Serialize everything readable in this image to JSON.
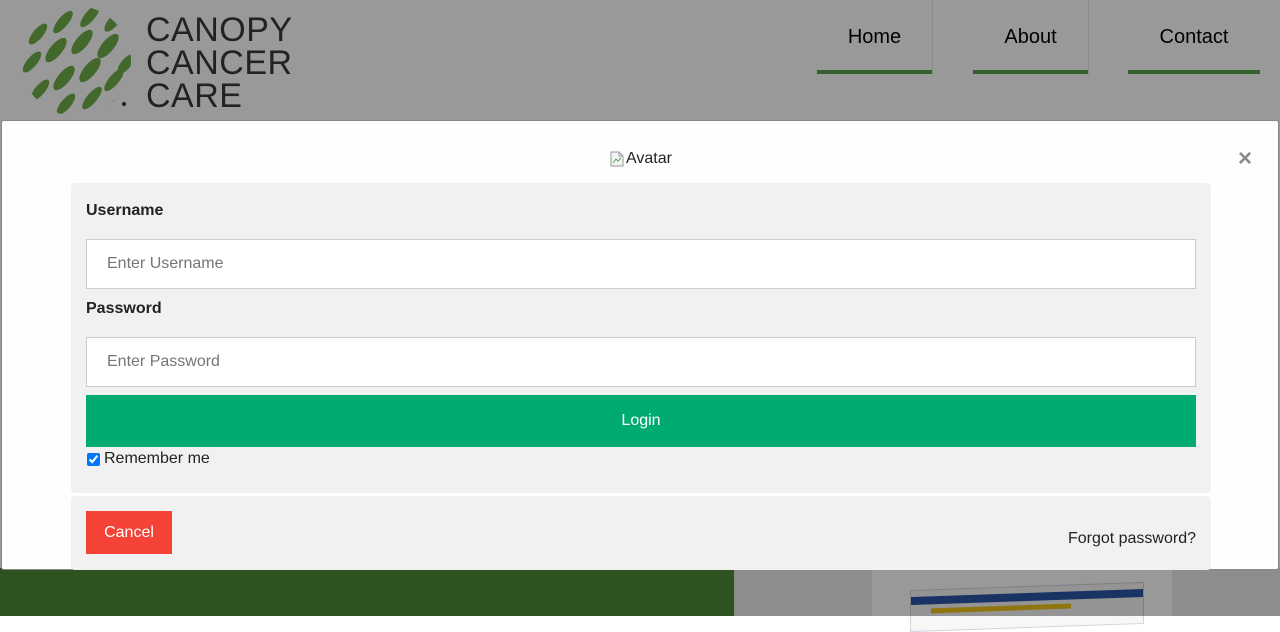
{
  "header": {
    "logo_lines": [
      "CANOPY",
      "CANCER",
      "CARE"
    ],
    "logo_mark": "leaf-sphere-logo",
    "nav": [
      {
        "label": "Home"
      },
      {
        "label": "About"
      },
      {
        "label": "Contact"
      }
    ]
  },
  "modal": {
    "avatar_alt": "Avatar",
    "close_symbol": "×",
    "username": {
      "label": "Username",
      "placeholder": "Enter Username",
      "value": ""
    },
    "password": {
      "label": "Password",
      "placeholder": "Enter Password",
      "value": ""
    },
    "login_label": "Login",
    "remember_label": "Remember me",
    "remember_checked": true,
    "cancel_label": "Cancel",
    "forgot_label": "Forgot password?"
  },
  "colors": {
    "brand_green": "#55a24b",
    "login_button": "#00aa73",
    "cancel_button": "#f44336",
    "band_green": "#4d8b38"
  }
}
